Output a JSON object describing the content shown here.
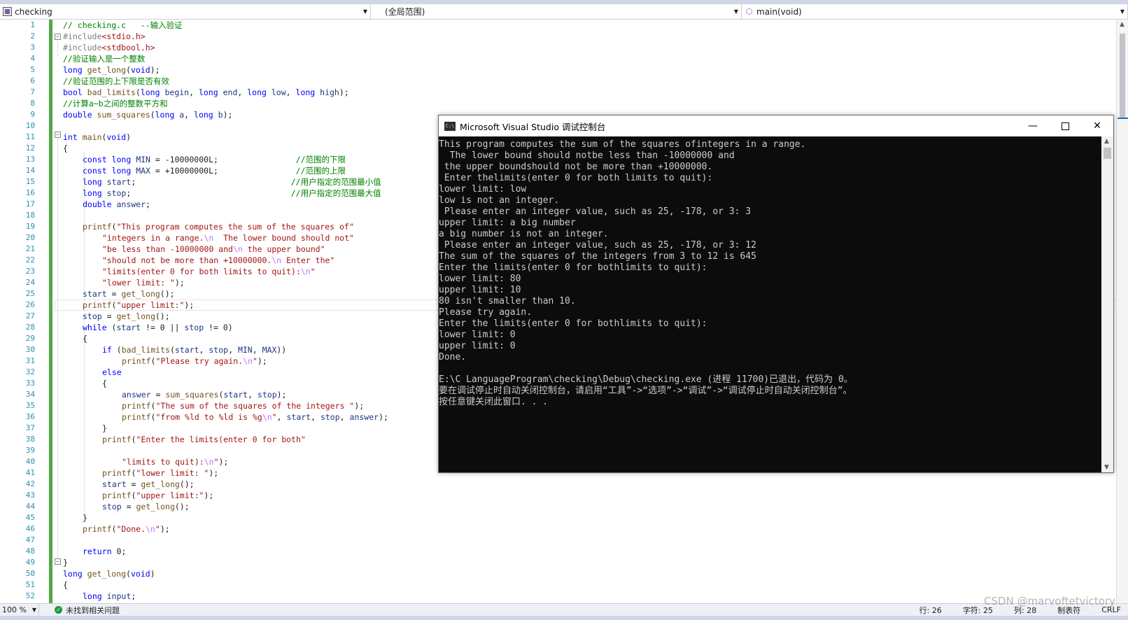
{
  "navbar": {
    "project": "checking",
    "scope": "(全局范围)",
    "function": "main(void)"
  },
  "editor": {
    "line_numbers": [
      "1",
      "2",
      "3",
      "4",
      "5",
      "6",
      "7",
      "8",
      "9",
      "10",
      "11",
      "12",
      "13",
      "14",
      "15",
      "16",
      "17",
      "18",
      "19",
      "20",
      "21",
      "22",
      "23",
      "24",
      "25",
      "26",
      "27",
      "28",
      "29",
      "30",
      "31",
      "32",
      "33",
      "34",
      "35",
      "36",
      "37",
      "38",
      "39",
      "40",
      "41",
      "42",
      "43",
      "44",
      "45",
      "46",
      "47",
      "48",
      "49",
      "50",
      "51",
      "52"
    ]
  },
  "console": {
    "title": "Microsoft Visual Studio 调试控制台",
    "icon_label": "C:\\",
    "lines": [
      "This program computes the sum of the squares ofintegers in a range.",
      "  The lower bound should notbe less than -10000000 and",
      " the upper boundshould not be more than +10000000.",
      " Enter thelimits(enter 0 for both limits to quit):",
      "lower limit: low",
      "low is not an integer.",
      " Please enter an integer value, such as 25, -178, or 3: 3",
      "upper limit: a big number",
      "a big number is not an integer.",
      " Please enter an integer value, such as 25, -178, or 3: 12",
      "The sum of the squares of the integers from 3 to 12 is 645",
      "Enter the limits(enter 0 for bothlimits to quit):",
      "lower limit: 80",
      "upper limit: 10",
      "80 isn't smaller than 10.",
      "Please try again.",
      "Enter the limits(enter 0 for bothlimits to quit):",
      "lower limit: 0",
      "upper limit: 0",
      "Done.",
      "",
      "E:\\C LanguageProgram\\checking\\Debug\\checking.exe (进程 11700)已退出，代码为 0。",
      "要在调试停止时自动关闭控制台，请启用“工具”->“选项”->“调试”->“调试停止时自动关闭控制台”。",
      "按任意键关闭此窗口. . ."
    ]
  },
  "statusbar": {
    "zoom": "100 %",
    "issues": "未找到相关问题",
    "line": "行: 26",
    "char": "字符: 25",
    "col": "列: 28",
    "mode": "制表符",
    "eol": "CRLF"
  },
  "watermark": "CSDN @marvoftetvictory"
}
